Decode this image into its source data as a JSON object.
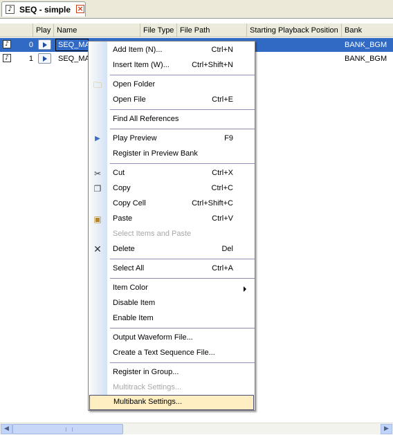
{
  "tab": {
    "title": "SEQ - simple",
    "icon": "music-note-icon",
    "close": "×"
  },
  "columns": [
    "",
    "Play",
    "Name",
    "File Type",
    "File Path",
    "Starting Playback Position",
    "Bank"
  ],
  "rows": [
    {
      "index": "0",
      "name": "SEQ_MA",
      "bank": "BANK_BGM",
      "selected": true
    },
    {
      "index": "1",
      "name": "SEQ_MA",
      "bank": "BANK_BGM",
      "selected": false
    }
  ],
  "context_menu": {
    "items": [
      {
        "label": "Add Item (N)...",
        "shortcut": "Ctrl+N"
      },
      {
        "label": "Insert Item (W)...",
        "shortcut": "Ctrl+Shift+N"
      },
      {
        "label": "Open Folder",
        "shortcut": "",
        "icon": "folder-search-icon"
      },
      {
        "label": "Open File",
        "shortcut": "Ctrl+E"
      },
      {
        "label": "Find All References",
        "shortcut": ""
      },
      {
        "label": "Play Preview",
        "shortcut": "F9",
        "icon": "play-icon"
      },
      {
        "label": "Register in Preview Bank",
        "shortcut": ""
      },
      {
        "label": "Cut",
        "shortcut": "Ctrl+X",
        "icon": "scissors-icon"
      },
      {
        "label": "Copy",
        "shortcut": "Ctrl+C",
        "icon": "copy-icon"
      },
      {
        "label": "Copy Cell",
        "shortcut": "Ctrl+Shift+C"
      },
      {
        "label": "Paste",
        "shortcut": "Ctrl+V",
        "icon": "paste-icon"
      },
      {
        "label": "Select Items and Paste",
        "shortcut": "",
        "disabled": true
      },
      {
        "label": "Delete",
        "shortcut": "Del",
        "icon": "delete-x-icon"
      },
      {
        "label": "Select All",
        "shortcut": "Ctrl+A"
      },
      {
        "label": "Item Color",
        "shortcut": "",
        "submenu": true
      },
      {
        "label": "Disable Item",
        "shortcut": ""
      },
      {
        "label": "Enable Item",
        "shortcut": ""
      },
      {
        "label": "Output Waveform File...",
        "shortcut": ""
      },
      {
        "label": "Create a Text Sequence File...",
        "shortcut": ""
      },
      {
        "label": "Register in Group...",
        "shortcut": ""
      },
      {
        "label": "Multitrack Settings...",
        "shortcut": "",
        "disabled": true
      },
      {
        "label": "Multibank Settings...",
        "shortcut": "",
        "highlighted": true
      }
    ]
  },
  "colors": {
    "selection": "#316ac5",
    "menu_highlight": "#ffeec2",
    "header": "#ebeadb"
  }
}
